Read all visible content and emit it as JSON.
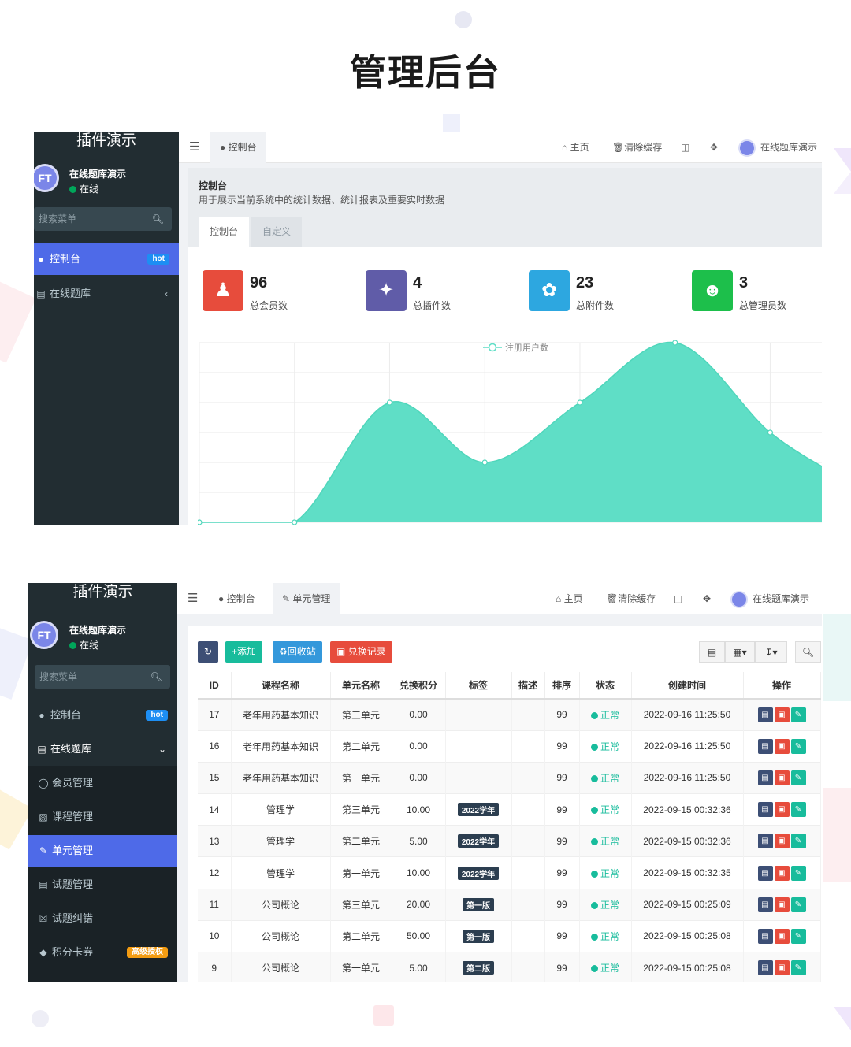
{
  "page": {
    "title": "管理后台"
  },
  "brand": "插件演示",
  "user": {
    "name": "在线题库演示",
    "status": "在线"
  },
  "search_placeholder": "搜索菜单",
  "top": {
    "tab_dashboard": "控制台",
    "tab_unit": "单元管理",
    "home": "主页",
    "clear_cache": "清除缓存",
    "username": "在线题库演示"
  },
  "sidebar1": {
    "items": [
      {
        "label": "控制台",
        "badge": "hot"
      },
      {
        "label": "在线题库"
      }
    ]
  },
  "sidebar2": {
    "items": [
      {
        "label": "控制台",
        "badge": "hot"
      },
      {
        "label": "在线题库"
      }
    ],
    "sub": [
      {
        "label": "会员管理"
      },
      {
        "label": "课程管理"
      },
      {
        "label": "单元管理"
      },
      {
        "label": "试题管理"
      },
      {
        "label": "试题纠错"
      },
      {
        "label": "积分卡券",
        "badge": "高级授权"
      }
    ]
  },
  "dashboard": {
    "title": "控制台",
    "desc": "用于展示当前系统中的统计数据、统计报表及重要实时数据",
    "tabs": [
      "控制台",
      "自定义"
    ],
    "stats": [
      {
        "value": "96",
        "label": "总会员数",
        "color": "#e74c3c",
        "icon": "users-icon"
      },
      {
        "value": "4",
        "label": "总插件数",
        "color": "#605ca8",
        "icon": "magic-icon"
      },
      {
        "value": "23",
        "label": "总附件数",
        "color": "#2da7e0",
        "icon": "leaf-icon"
      },
      {
        "value": "3",
        "label": "总管理员数",
        "color": "#1dbf4b",
        "icon": "user-icon"
      }
    ]
  },
  "chart_data": {
    "type": "area",
    "legend": "注册用户数",
    "legend_position": "top-center",
    "grid": true,
    "values": [
      0,
      0,
      4,
      2,
      4,
      6,
      3
    ],
    "color": "#5fdec6"
  },
  "unit_table": {
    "buttons": {
      "add": "添加",
      "recycle": "回收站",
      "exchange": "兑换记录"
    },
    "headers": [
      "ID",
      "课程名称",
      "单元名称",
      "兑换积分",
      "标签",
      "描述",
      "排序",
      "状态",
      "创建时间",
      "操作"
    ],
    "rows": [
      {
        "id": "17",
        "course": "老年用药基本知识",
        "unit": "第三单元",
        "points": "0.00",
        "tag": "",
        "sort": "99",
        "status": "正常",
        "time": "2022-09-16 11:25:50"
      },
      {
        "id": "16",
        "course": "老年用药基本知识",
        "unit": "第二单元",
        "points": "0.00",
        "tag": "",
        "sort": "99",
        "status": "正常",
        "time": "2022-09-16 11:25:50"
      },
      {
        "id": "15",
        "course": "老年用药基本知识",
        "unit": "第一单元",
        "points": "0.00",
        "tag": "",
        "sort": "99",
        "status": "正常",
        "time": "2022-09-16 11:25:50"
      },
      {
        "id": "14",
        "course": "管理学",
        "unit": "第三单元",
        "points": "10.00",
        "tag": "2022学年",
        "sort": "99",
        "status": "正常",
        "time": "2022-09-15 00:32:36"
      },
      {
        "id": "13",
        "course": "管理学",
        "unit": "第二单元",
        "points": "5.00",
        "tag": "2022学年",
        "sort": "99",
        "status": "正常",
        "time": "2022-09-15 00:32:36"
      },
      {
        "id": "12",
        "course": "管理学",
        "unit": "第一单元",
        "points": "10.00",
        "tag": "2022学年",
        "sort": "99",
        "status": "正常",
        "time": "2022-09-15 00:32:35"
      },
      {
        "id": "11",
        "course": "公司概论",
        "unit": "第三单元",
        "points": "20.00",
        "tag": "第一版",
        "sort": "99",
        "status": "正常",
        "time": "2022-09-15 00:25:09"
      },
      {
        "id": "10",
        "course": "公司概论",
        "unit": "第二单元",
        "points": "50.00",
        "tag": "第一版",
        "sort": "99",
        "status": "正常",
        "time": "2022-09-15 00:25:08"
      },
      {
        "id": "9",
        "course": "公司概论",
        "unit": "第一单元",
        "points": "5.00",
        "tag": "第二版",
        "sort": "99",
        "status": "正常",
        "time": "2022-09-15 00:25:08"
      }
    ]
  }
}
